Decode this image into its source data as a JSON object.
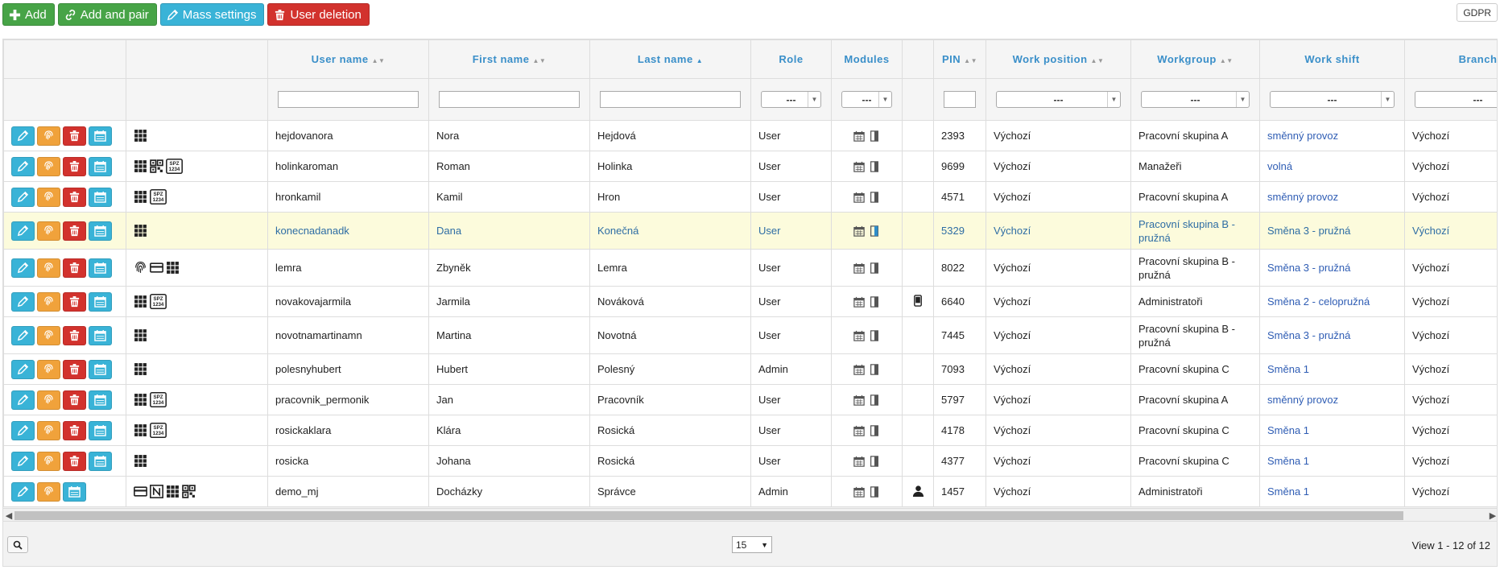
{
  "toolbar": {
    "add_label": "Add",
    "add_pair_label": "Add and pair",
    "mass_settings_label": "Mass settings",
    "user_deletion_label": "User deletion"
  },
  "gdpr_label": "GDPR",
  "columns": {
    "user_name": "User name",
    "first_name": "First name",
    "last_name": "Last name",
    "role": "Role",
    "modules": "Modules",
    "pin": "PIN",
    "work_position": "Work position",
    "workgroup": "Workgroup",
    "work_shift": "Work shift",
    "branch": "Branch"
  },
  "filters": {
    "select_placeholder": "---"
  },
  "rows": [
    {
      "user": "hejdovanora",
      "first": "Nora",
      "last": "Hejdová",
      "role": "User",
      "pin": "2393",
      "position": "Výchozí",
      "group": "Pracovní skupina A",
      "shift": "směnný provoz",
      "branch": "Výchozí"
    },
    {
      "user": "holinkaroman",
      "first": "Roman",
      "last": "Holinka",
      "role": "User",
      "pin": "9699",
      "position": "Výchozí",
      "group": "Manažeři",
      "shift": "volná",
      "branch": "Výchozí"
    },
    {
      "user": "hronkamil",
      "first": "Kamil",
      "last": "Hron",
      "role": "User",
      "pin": "4571",
      "position": "Výchozí",
      "group": "Pracovní skupina A",
      "shift": "směnný provoz",
      "branch": "Výchozí"
    },
    {
      "user": "konecnadanadk",
      "first": "Dana",
      "last": "Konečná",
      "role": "User",
      "pin": "5329",
      "position": "Výchozí",
      "group": "Pracovní skupina B - pružná",
      "shift": "Směna 3 - pružná",
      "branch": "Výchozí"
    },
    {
      "user": "lemra",
      "first": "Zbyněk",
      "last": "Lemra",
      "role": "User",
      "pin": "8022",
      "position": "Výchozí",
      "group": "Pracovní skupina B - pružná",
      "shift": "Směna 3 - pružná",
      "branch": "Výchozí"
    },
    {
      "user": "novakovajarmila",
      "first": "Jarmila",
      "last": "Nováková",
      "role": "User",
      "pin": "6640",
      "position": "Výchozí",
      "group": "Administratoři",
      "shift": "Směna 2 - celopružná",
      "branch": "Výchozí"
    },
    {
      "user": "novotnamartinamn",
      "first": "Martina",
      "last": "Novotná",
      "role": "User",
      "pin": "7445",
      "position": "Výchozí",
      "group": "Pracovní skupina B - pružná",
      "shift": "Směna 3 - pružná",
      "branch": "Výchozí"
    },
    {
      "user": "polesnyhubert",
      "first": "Hubert",
      "last": "Polesný",
      "role": "Admin",
      "pin": "7093",
      "position": "Výchozí",
      "group": "Pracovní skupina C",
      "shift": "Směna 1",
      "branch": "Výchozí"
    },
    {
      "user": "pracovnik_permonik",
      "first": "Jan",
      "last": "Pracovník",
      "role": "User",
      "pin": "5797",
      "position": "Výchozí",
      "group": "Pracovní skupina A",
      "shift": "směnný provoz",
      "branch": "Výchozí"
    },
    {
      "user": "rosickaklara",
      "first": "Klára",
      "last": "Rosická",
      "role": "User",
      "pin": "4178",
      "position": "Výchozí",
      "group": "Pracovní skupina C",
      "shift": "Směna 1",
      "branch": "Výchozí"
    },
    {
      "user": "rosicka",
      "first": "Johana",
      "last": "Rosická",
      "role": "User",
      "pin": "4377",
      "position": "Výchozí",
      "group": "Pracovní skupina C",
      "shift": "Směna 1",
      "branch": "Výchozí"
    },
    {
      "user": "demo_mj",
      "first": "Docházky",
      "last": "Správce",
      "role": "Admin",
      "pin": "1457",
      "position": "Výchozí",
      "group": "Administratoři",
      "shift": "Směna 1",
      "branch": "Výchozí"
    }
  ],
  "spz_text_top": "SPZ",
  "spz_text_bottom": "1234",
  "pager": {
    "page_size": "15",
    "view_info": "View 1 - 12 of 12"
  },
  "colors": {
    "green": "#47a447",
    "blue": "#39b3d7",
    "red": "#d2322d",
    "orange": "#f0a23b",
    "header_text": "#3a8fc9",
    "highlight_row": "#fcfbdc"
  }
}
